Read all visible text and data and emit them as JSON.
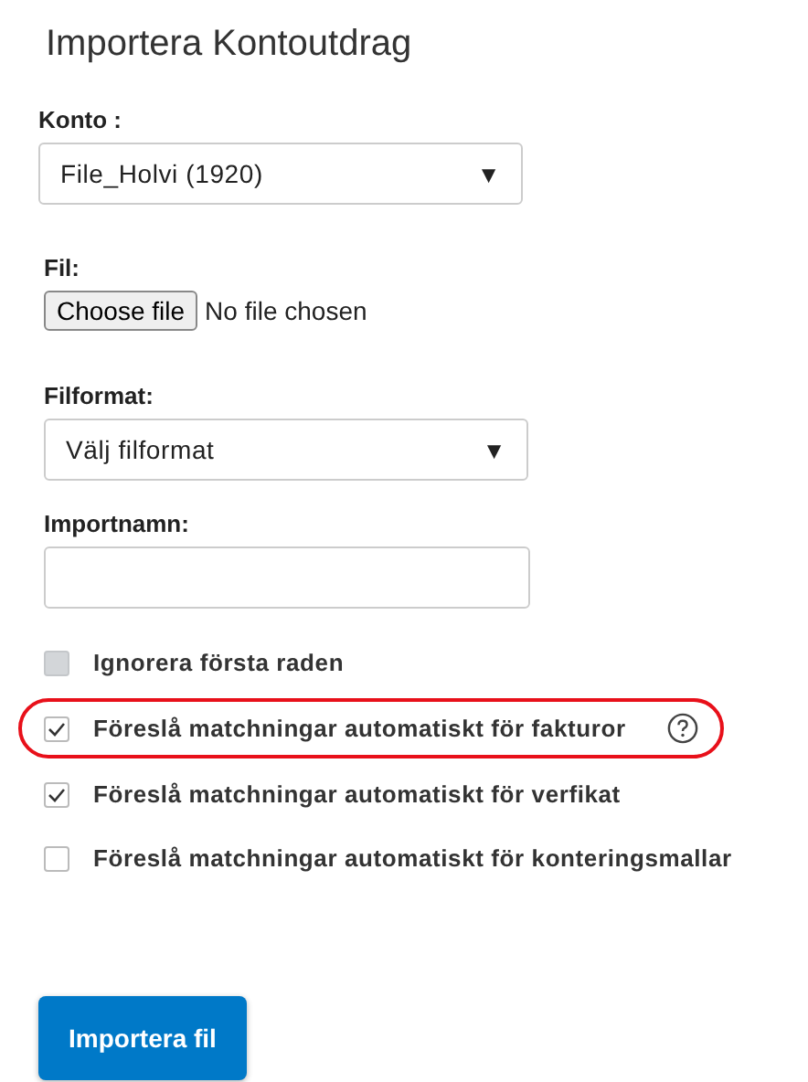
{
  "title": "Importera Kontoutdrag",
  "account": {
    "label": "Konto :",
    "value": "File_Holvi (1920)",
    "caret": "▼"
  },
  "file": {
    "label": "Fil:",
    "button": "Choose file",
    "status": "No file chosen"
  },
  "format": {
    "label": "Filformat:",
    "value": "Välj filformat",
    "caret": "▼"
  },
  "import_name": {
    "label": "Importnamn:"
  },
  "options": [
    {
      "label": "Ignorera första raden",
      "checked": false,
      "disabled": true,
      "highlighted": false,
      "help": false
    },
    {
      "label": "Föreslå matchningar automatiskt för fakturor",
      "checked": true,
      "disabled": false,
      "highlighted": true,
      "help": true
    },
    {
      "label": "Föreslå matchningar automatiskt för verfikat",
      "checked": true,
      "disabled": false,
      "highlighted": false,
      "help": false
    },
    {
      "label": "Föreslå matchningar automatiskt för konteringsmallar",
      "checked": false,
      "disabled": false,
      "highlighted": false,
      "help": false
    }
  ],
  "submit": "Importera fil"
}
